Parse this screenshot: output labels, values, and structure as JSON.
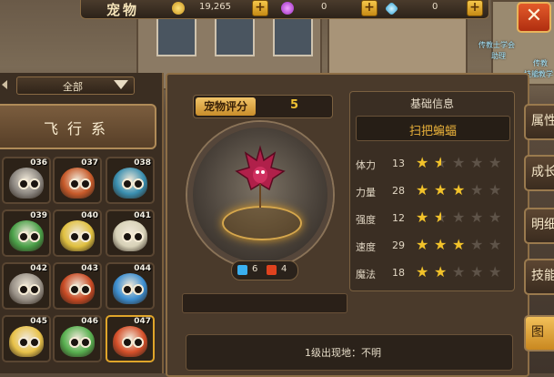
{
  "topbar": {
    "title": "宠物",
    "gold": "19,265",
    "gem": "0",
    "diamond": "0"
  },
  "npc_labels": [
    "传教士学会",
    "助理",
    "传教士",
    "技能教学"
  ],
  "left": {
    "filter_label": "全部",
    "category_label": "飞行系",
    "pets": [
      {
        "num": "036",
        "color": "#8b8680"
      },
      {
        "num": "037",
        "color": "#c75a2a"
      },
      {
        "num": "038",
        "color": "#3a8fb0"
      },
      {
        "num": "039",
        "color": "#4aa048"
      },
      {
        "num": "040",
        "color": "#e0c040"
      },
      {
        "num": "041",
        "color": "#d8d2b8"
      },
      {
        "num": "042",
        "color": "#9a9288"
      },
      {
        "num": "043",
        "color": "#c84a24"
      },
      {
        "num": "044",
        "color": "#3c8ed0"
      },
      {
        "num": "045",
        "color": "#e8c24a"
      },
      {
        "num": "046",
        "color": "#58b050"
      },
      {
        "num": "047",
        "color": "#d6502a"
      }
    ],
    "selected_pet": "047"
  },
  "center": {
    "score_label": "宠物评分",
    "score_value": "5",
    "elem_water": "6",
    "elem_fire": "4",
    "origin_text": "1级出现地：不明"
  },
  "info": {
    "title": "基础信息",
    "pet_name": "扫把蝙蝠",
    "stats": [
      {
        "label": "体力",
        "value": "13",
        "stars": 1.5
      },
      {
        "label": "力量",
        "value": "28",
        "stars": 3
      },
      {
        "label": "强度",
        "value": "12",
        "stars": 1.5
      },
      {
        "label": "速度",
        "value": "29",
        "stars": 3
      },
      {
        "label": "魔法",
        "value": "18",
        "stars": 2
      }
    ]
  },
  "tabs": [
    "属性",
    "成长",
    "明细",
    "技能",
    "图"
  ],
  "colors": {
    "accent": "#f2c22a",
    "name": "#e9b13a",
    "close": "#c93c18"
  }
}
